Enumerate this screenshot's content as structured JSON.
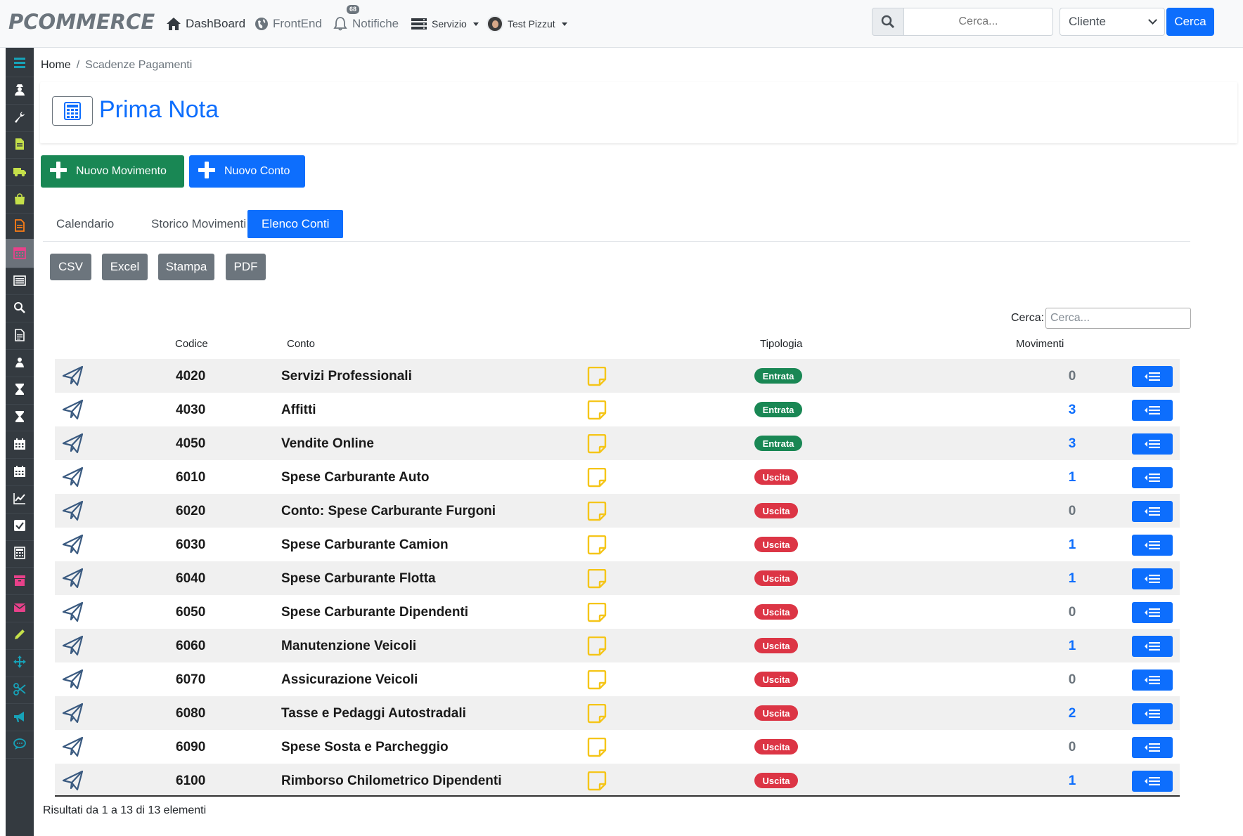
{
  "app": {
    "logo": "PCOMMERCE"
  },
  "nav": {
    "dashboard": "DashBoard",
    "frontend": "FrontEnd",
    "notifiche": "Notifiche",
    "notifiche_count": "68",
    "servizio": "Servizio",
    "user": "Test Pizzut"
  },
  "topsearch": {
    "placeholder": "Cerca...",
    "select_value": "Cliente",
    "button": "Cerca"
  },
  "sidebar": {
    "items": [
      "menu-icon",
      "user-secret-icon",
      "wrench-icon",
      "file-icon",
      "truck-icon",
      "shopping-bag-icon",
      "file-text-icon",
      "calendar-grid-icon",
      "list-icon",
      "search-icon",
      "document-icon",
      "users-icon",
      "hourglass-icon",
      "hourglass-icon",
      "calendar-icon",
      "calendar-icon",
      "line-chart-icon",
      "check-square-icon",
      "calculator-icon",
      "archive-icon",
      "envelope-icon",
      "pencil-icon",
      "arrows-icon",
      "scissors-icon",
      "bullhorn-icon",
      "comment-icon"
    ],
    "colors": {
      "menu-icon": "#17a2b8",
      "file-icon": "#c5e04a",
      "truck-icon": "#c5e04a",
      "shopping-bag-icon": "#c5e04a",
      "file-text-icon": "#fd7e14",
      "calendar-grid-icon": "#e8418a",
      "archive-icon": "#e8418a",
      "envelope-icon": "#e8418a",
      "pencil-icon": "#c5e04a",
      "arrows-icon": "#17a2b8",
      "scissors-icon": "#17a2b8",
      "bullhorn-icon": "#17a2b8",
      "comment-icon": "#17a2b8"
    }
  },
  "breadcrumb": {
    "home": "Home",
    "separator": "/",
    "current": "Scadenze Pagamenti"
  },
  "page": {
    "title": "Prima Nota"
  },
  "actions": {
    "nuovo_movimento": "Nuovo Movimento",
    "nuovo_conto": "Nuovo Conto"
  },
  "tabs": [
    "Calendario",
    "Storico Movimenti",
    "Elenco Conti"
  ],
  "export": [
    "CSV",
    "Excel",
    "Stampa",
    "PDF"
  ],
  "table": {
    "search_label": "Cerca:",
    "search_placeholder": "Cerca...",
    "headers": {
      "codice": "Codice",
      "conto": "Conto",
      "tipologia": "Tipologia",
      "movimenti": "Movimenti"
    },
    "rows": [
      {
        "codice": "4020",
        "conto": "Servizi Professionali",
        "tipologia": "Entrata",
        "movimenti": "0"
      },
      {
        "codice": "4030",
        "conto": "Affitti",
        "tipologia": "Entrata",
        "movimenti": "3"
      },
      {
        "codice": "4050",
        "conto": "Vendite Online",
        "tipologia": "Entrata",
        "movimenti": "3"
      },
      {
        "codice": "6010",
        "conto": "Spese Carburante Auto",
        "tipologia": "Uscita",
        "movimenti": "1"
      },
      {
        "codice": "6020",
        "conto": "Conto: Spese Carburante Furgoni",
        "tipologia": "Uscita",
        "movimenti": "0"
      },
      {
        "codice": "6030",
        "conto": "Spese Carburante Camion",
        "tipologia": "Uscita",
        "movimenti": "1"
      },
      {
        "codice": "6040",
        "conto": "Spese Carburante Flotta",
        "tipologia": "Uscita",
        "movimenti": "1"
      },
      {
        "codice": "6050",
        "conto": "Spese Carburante Dipendenti",
        "tipologia": "Uscita",
        "movimenti": "0"
      },
      {
        "codice": "6060",
        "conto": "Manutenzione Veicoli",
        "tipologia": "Uscita",
        "movimenti": "1"
      },
      {
        "codice": "6070",
        "conto": "Assicurazione Veicoli",
        "tipologia": "Uscita",
        "movimenti": "0"
      },
      {
        "codice": "6080",
        "conto": "Tasse e Pedaggi Autostradali",
        "tipologia": "Uscita",
        "movimenti": "2"
      },
      {
        "codice": "6090",
        "conto": "Spese Sosta e Parcheggio",
        "tipologia": "Uscita",
        "movimenti": "0"
      },
      {
        "codice": "6100",
        "conto": "Rimborso Chilometrico Dipendenti",
        "tipologia": "Uscita",
        "movimenti": "1"
      }
    ],
    "footer": "Risultati da 1 a 13 di 13 elementi"
  },
  "colors": {
    "primary": "#0d6efd",
    "success": "#198754",
    "danger": "#dc3545",
    "secondary": "#6c757d",
    "note": "#f5c518"
  }
}
